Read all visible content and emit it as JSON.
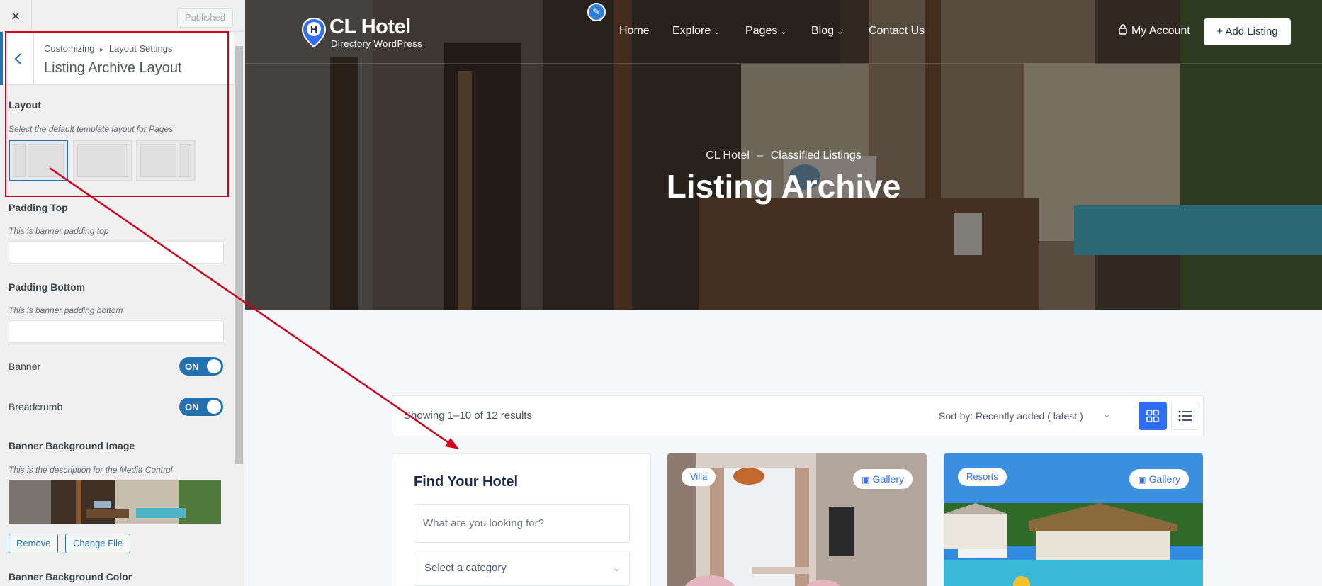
{
  "customizer": {
    "close_icon": "×",
    "publish_label": "Published",
    "breadcrumb_root": "Customizing",
    "breadcrumb_sep": "▸",
    "breadcrumb_parent": "Layout Settings",
    "section_title": "Listing Archive Layout",
    "layout": {
      "label": "Layout",
      "description": "Select the default template layout for Pages",
      "options": [
        "left-sidebar",
        "full-width",
        "right-sidebar"
      ],
      "selected": "left-sidebar"
    },
    "padding_top": {
      "label": "Padding Top",
      "description": "This is banner padding top",
      "value": ""
    },
    "padding_bottom": {
      "label": "Padding Bottom",
      "description": "This is banner padding bottom",
      "value": ""
    },
    "banner": {
      "label": "Banner",
      "state": "ON"
    },
    "breadcrumb": {
      "label": "Breadcrumb",
      "state": "ON"
    },
    "banner_bg_image": {
      "label": "Banner Background Image",
      "description": "This is the description for the Media Control",
      "remove_label": "Remove",
      "change_label": "Change File"
    },
    "banner_bg_color": {
      "label": "Banner Background Color"
    }
  },
  "site": {
    "logo_title": "CL Hotel",
    "logo_subtitle": "Directory WordPress",
    "nav": [
      {
        "label": "Home",
        "dropdown": false
      },
      {
        "label": "Explore",
        "dropdown": true
      },
      {
        "label": "Pages",
        "dropdown": true
      },
      {
        "label": "Blog",
        "dropdown": true
      },
      {
        "label": "Contact Us",
        "dropdown": false
      }
    ],
    "account_label": "My Account",
    "add_listing_label": "+ Add Listing",
    "breadcrumb_home": "CL Hotel",
    "breadcrumb_sep": "–",
    "breadcrumb_current": "Classified Listings",
    "hero_title": "Listing Archive",
    "results_text": "Showing 1–10 of 12 results",
    "sort_label": "Sort by:",
    "sort_value": "Recently added ( latest )",
    "search_title": "Find Your Hotel",
    "search_placeholder": "What are you looking for?",
    "category_placeholder": "Select a category",
    "cards": [
      {
        "badge": "Villa",
        "gallery_label": "Gallery"
      },
      {
        "badge": "Resorts",
        "gallery_label": "Gallery"
      }
    ]
  },
  "colors": {
    "accent": "#2271b1",
    "brand_blue": "#2f6df6",
    "annotation_red": "#d0021b"
  }
}
